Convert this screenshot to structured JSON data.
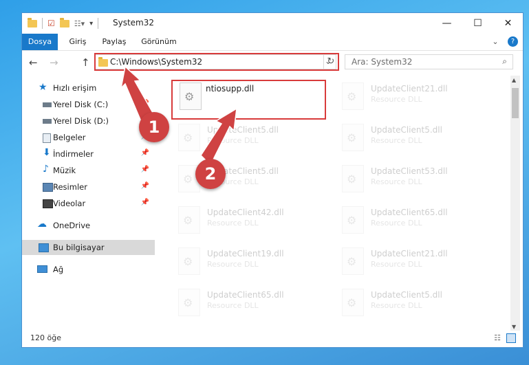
{
  "window": {
    "title": "System32",
    "controls": {
      "minimize": "—",
      "maximize": "☐",
      "close": "✕"
    }
  },
  "ribbon": {
    "tabs": [
      {
        "label": "Dosya",
        "active": true
      },
      {
        "label": "Giriş",
        "active": false
      },
      {
        "label": "Paylaş",
        "active": false
      },
      {
        "label": "Görünüm",
        "active": false
      }
    ],
    "expand": "⌄",
    "help": "?"
  },
  "nav": {
    "back": "←",
    "forward": "→",
    "up": "↑",
    "address": "C:\\Windows\\System32",
    "refresh": "↻",
    "dropdown": "⌄"
  },
  "search": {
    "placeholder": "Ara: System32",
    "icon": "search-icon"
  },
  "sidebar": {
    "items": [
      {
        "label": "Hızlı erişim",
        "icon": "star-icon",
        "pinned": false
      },
      {
        "label": "Yerel Disk (C:)",
        "icon": "drive-icon",
        "pinned": true
      },
      {
        "label": "Yerel Disk (D:)",
        "icon": "drive-icon",
        "pinned": true
      },
      {
        "label": "Belgeler",
        "icon": "document-icon",
        "pinned": true
      },
      {
        "label": "İndirmeler",
        "icon": "download-icon",
        "pinned": true
      },
      {
        "label": "Müzik",
        "icon": "music-icon",
        "pinned": true
      },
      {
        "label": "Resimler",
        "icon": "pictures-icon",
        "pinned": true
      },
      {
        "label": "Videolar",
        "icon": "video-icon",
        "pinned": true
      },
      {
        "label": "OneDrive",
        "icon": "cloud-icon",
        "pinned": false
      },
      {
        "label": "Bu bilgisayar",
        "icon": "computer-icon",
        "pinned": false,
        "selected": true
      },
      {
        "label": "Ağ",
        "icon": "network-icon",
        "pinned": false
      }
    ],
    "pin_glyph": "📌"
  },
  "files": {
    "left": [
      {
        "name": "ntiosupp.dll",
        "type": ""
      },
      {
        "name": "UpdateClient5.dll",
        "type": "Resource DLL"
      },
      {
        "name": "UpdateClient5.dll",
        "type": "Resource DLL"
      },
      {
        "name": "UpdateClient42.dll",
        "type": "Resource DLL"
      },
      {
        "name": "UpdateClient19.dll",
        "type": "Resource DLL"
      },
      {
        "name": "UpdateClient65.dll",
        "type": "Resource DLL"
      }
    ],
    "right": [
      {
        "name": "UpdateClient21.dll",
        "type": "Resource DLL"
      },
      {
        "name": "UpdateClient5.dll",
        "type": "Resource DLL"
      },
      {
        "name": "UpdateClient53.dll",
        "type": "Resource DLL"
      },
      {
        "name": "UpdateClient65.dll",
        "type": "Resource DLL"
      },
      {
        "name": "UpdateClient21.dll",
        "type": "Resource DLL"
      },
      {
        "name": "UpdateClient5.dll",
        "type": "Resource DLL"
      }
    ]
  },
  "status": {
    "count": "120 öğe"
  },
  "annotations": {
    "step1": "1",
    "step2": "2",
    "color": "#d83a3a"
  }
}
